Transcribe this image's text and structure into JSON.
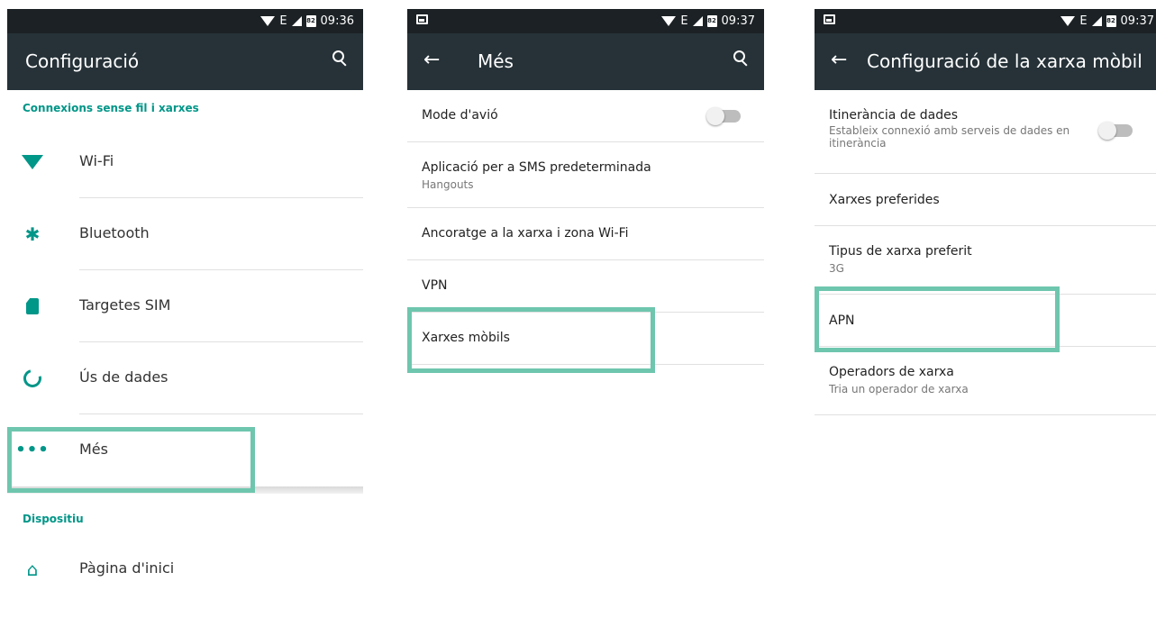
{
  "screen1": {
    "status": {
      "time": "09:36",
      "network": "E",
      "battery": "82"
    },
    "title": "Configuració",
    "sections": [
      {
        "category": "Connexions sense fil i xarxes",
        "items": [
          {
            "label": "Wi-Fi",
            "icon": "wifi-icon"
          },
          {
            "label": "Bluetooth",
            "icon": "bluetooth-icon"
          },
          {
            "label": "Targetes SIM",
            "icon": "sim-card-icon"
          },
          {
            "label": "Ús de dades",
            "icon": "data-usage-icon"
          },
          {
            "label": "Més",
            "icon": "more-dots-icon"
          }
        ]
      },
      {
        "category": "Dispositiu",
        "items": [
          {
            "label": "Pàgina d'inici",
            "icon": "home-icon"
          }
        ]
      }
    ],
    "bt_glyph": "✱",
    "dots_glyph": "•••",
    "home_glyph": "⌂"
  },
  "screen2": {
    "status": {
      "time": "09:37",
      "network": "E",
      "battery": "82"
    },
    "back_glyph": "←",
    "title": "Més",
    "items": [
      {
        "label": "Mode d'avió",
        "toggle": "off"
      },
      {
        "label": "Aplicació per a SMS predeterminada",
        "summary": "Hangouts"
      },
      {
        "label": "Ancoratge a la xarxa i zona Wi-Fi"
      },
      {
        "label": "VPN"
      },
      {
        "label": "Xarxes mòbils"
      }
    ]
  },
  "screen3": {
    "status": {
      "time": "09:37",
      "network": "E",
      "battery": "82"
    },
    "back_glyph": "←",
    "title": "Configuració de la xarxa mòbil",
    "items": [
      {
        "label": "Itinerància de dades",
        "summary": "Estableix connexió amb serveis de dades en itinerància",
        "toggle": "off"
      },
      {
        "label": "Xarxes preferides"
      },
      {
        "label": "Tipus de xarxa preferit",
        "summary": "3G"
      },
      {
        "label": "APN"
      },
      {
        "label": "Operadors de xarxa",
        "summary": "Tria un operador de xarxa"
      }
    ]
  },
  "colors": {
    "toolbar": "#263238",
    "statusbar": "#1b2124",
    "accent": "#009688",
    "highlight": "#6ec6ae"
  }
}
